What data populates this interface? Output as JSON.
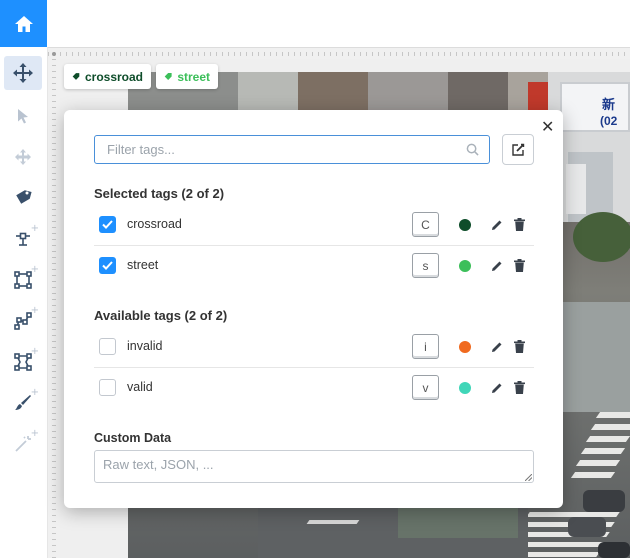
{
  "toolbar": {
    "home_icon": "home-icon",
    "tools": [
      {
        "name": "move-icon",
        "active": true
      },
      {
        "name": "pointer-icon",
        "active": false
      },
      {
        "name": "pan-icon",
        "active": false
      },
      {
        "name": "tag-icon",
        "active": false
      },
      {
        "name": "point-icon",
        "active": false
      },
      {
        "name": "rectangle-icon",
        "active": false
      },
      {
        "name": "polyline-icon",
        "active": false
      },
      {
        "name": "polygon-icon",
        "active": false
      },
      {
        "name": "brush-icon",
        "active": false
      },
      {
        "name": "magic-wand-icon",
        "active": false
      }
    ]
  },
  "applied_tags": [
    {
      "label": "crossroad",
      "color": "#0e4d2a"
    },
    {
      "label": "street",
      "color": "#3cbf5a"
    }
  ],
  "modal": {
    "filter_placeholder": "Filter tags...",
    "selected_heading": "Selected tags (2 of 2)",
    "selected": [
      {
        "label": "crossroad",
        "hotkey": "C",
        "color": "#0e4d2a",
        "checked": true
      },
      {
        "label": "street",
        "hotkey": "s",
        "color": "#3cbf5a",
        "checked": true
      }
    ],
    "available_heading": "Available tags (2 of 2)",
    "available": [
      {
        "label": "invalid",
        "hotkey": "i",
        "color": "#f06a1f",
        "checked": false
      },
      {
        "label": "valid",
        "hotkey": "v",
        "color": "#40d6b8",
        "checked": false
      }
    ],
    "custom_data_label": "Custom Data",
    "custom_data_placeholder": "Raw text, JSON, ..."
  },
  "background_sign": {
    "line1": "新",
    "line2": "(02"
  },
  "colors": {
    "accent": "#1e90ff",
    "toolbar_active": "#dfe8f5",
    "icon": "#39506b"
  }
}
